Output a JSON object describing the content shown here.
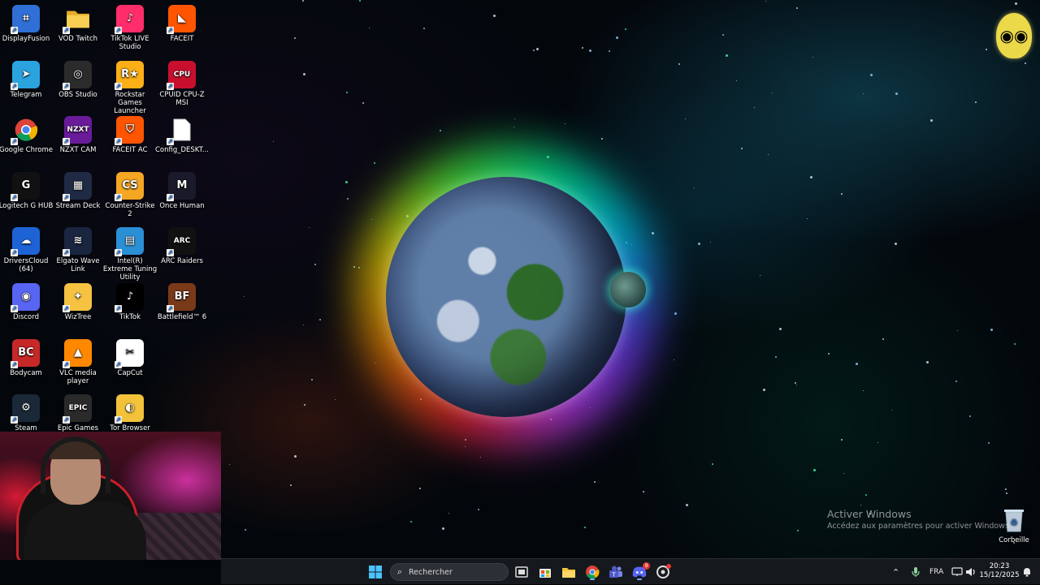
{
  "desktop": {
    "icons": [
      {
        "label": "DisplayFusion",
        "icon": "displayfusion-icon",
        "color": "#2f6fd6"
      },
      {
        "label": "VOD Twitch",
        "icon": "folder-icon",
        "color": "#f2c23a"
      },
      {
        "label": "TikTok LIVE Studio",
        "icon": "tiktok-live-icon",
        "color": "#ff2d6a"
      },
      {
        "label": "FACEIT",
        "icon": "faceit-icon",
        "color": "#ff5500"
      },
      {
        "label": "Telegram",
        "icon": "telegram-icon",
        "color": "#2aa3de"
      },
      {
        "label": "OBS Studio",
        "icon": "obs-icon",
        "color": "#2b2b2b"
      },
      {
        "label": "Rockstar Games Launcher",
        "icon": "rockstar-icon",
        "color": "#fcaf17"
      },
      {
        "label": "CPUID CPU-Z MSI",
        "icon": "cpuz-icon",
        "color": "#c8102e"
      },
      {
        "label": "Google Chrome",
        "icon": "chrome-icon",
        "color": "#4285f4"
      },
      {
        "label": "NZXT CAM",
        "icon": "nzxt-icon",
        "color": "#6a1b9a"
      },
      {
        "label": "FACEIT AC",
        "icon": "faceit-ac-icon",
        "color": "#ff5500"
      },
      {
        "label": "Config_DESKT...",
        "icon": "file-icon",
        "color": "#ffffff"
      },
      {
        "label": "Logitech G HUB",
        "icon": "logitech-icon",
        "color": "#111111"
      },
      {
        "label": "Stream Deck",
        "icon": "stream-deck-icon",
        "color": "#1f2a44"
      },
      {
        "label": "Counter-Strike 2",
        "icon": "cs2-icon",
        "color": "#f5a623"
      },
      {
        "label": "Once Human",
        "icon": "once-human-icon",
        "color": "#1a1a2a"
      },
      {
        "label": "DriversCloud (64)",
        "icon": "driverscloud-icon",
        "color": "#1e63d6"
      },
      {
        "label": "Elgato Wave Link",
        "icon": "wave-link-icon",
        "color": "#1a2540"
      },
      {
        "label": "Intel(R) Extreme Tuning Utility",
        "icon": "intel-xtu-icon",
        "color": "#2b8fd6"
      },
      {
        "label": "ARC Raiders",
        "icon": "arc-raiders-icon",
        "color": "#111111"
      },
      {
        "label": "Discord",
        "icon": "discord-icon",
        "color": "#5865f2"
      },
      {
        "label": "WizTree",
        "icon": "wiztree-icon",
        "color": "#f5c242"
      },
      {
        "label": "TikTok",
        "icon": "tiktok-icon",
        "color": "#000000"
      },
      {
        "label": "Battlefield™ 6",
        "icon": "battlefield-icon",
        "color": "#7a3a1a"
      },
      {
        "label": "Bodycam",
        "icon": "bodycam-icon",
        "color": "#c62828"
      },
      {
        "label": "VLC media player",
        "icon": "vlc-icon",
        "color": "#ff8800"
      },
      {
        "label": "CapCut",
        "icon": "capcut-icon",
        "color": "#ffffff"
      },
      {
        "label": "Steam",
        "icon": "steam-icon",
        "color": "#1b2838"
      },
      {
        "label": "Epic Games",
        "icon": "epic-games-icon",
        "color": "#2a2a2a"
      },
      {
        "label": "Tor Browser",
        "icon": "tor-browser-icon",
        "color": "#f2c23a"
      }
    ],
    "recycle_bin": {
      "label": "Corbeille"
    }
  },
  "watermark": {
    "title": "Activer Windows",
    "subtitle": "Accédez aux paramètres pour activer Windows."
  },
  "taskbar": {
    "search_placeholder": "Rechercher",
    "language": "FRA",
    "time": "20:23",
    "date": "15/12/2025",
    "discord_badge": "9"
  }
}
